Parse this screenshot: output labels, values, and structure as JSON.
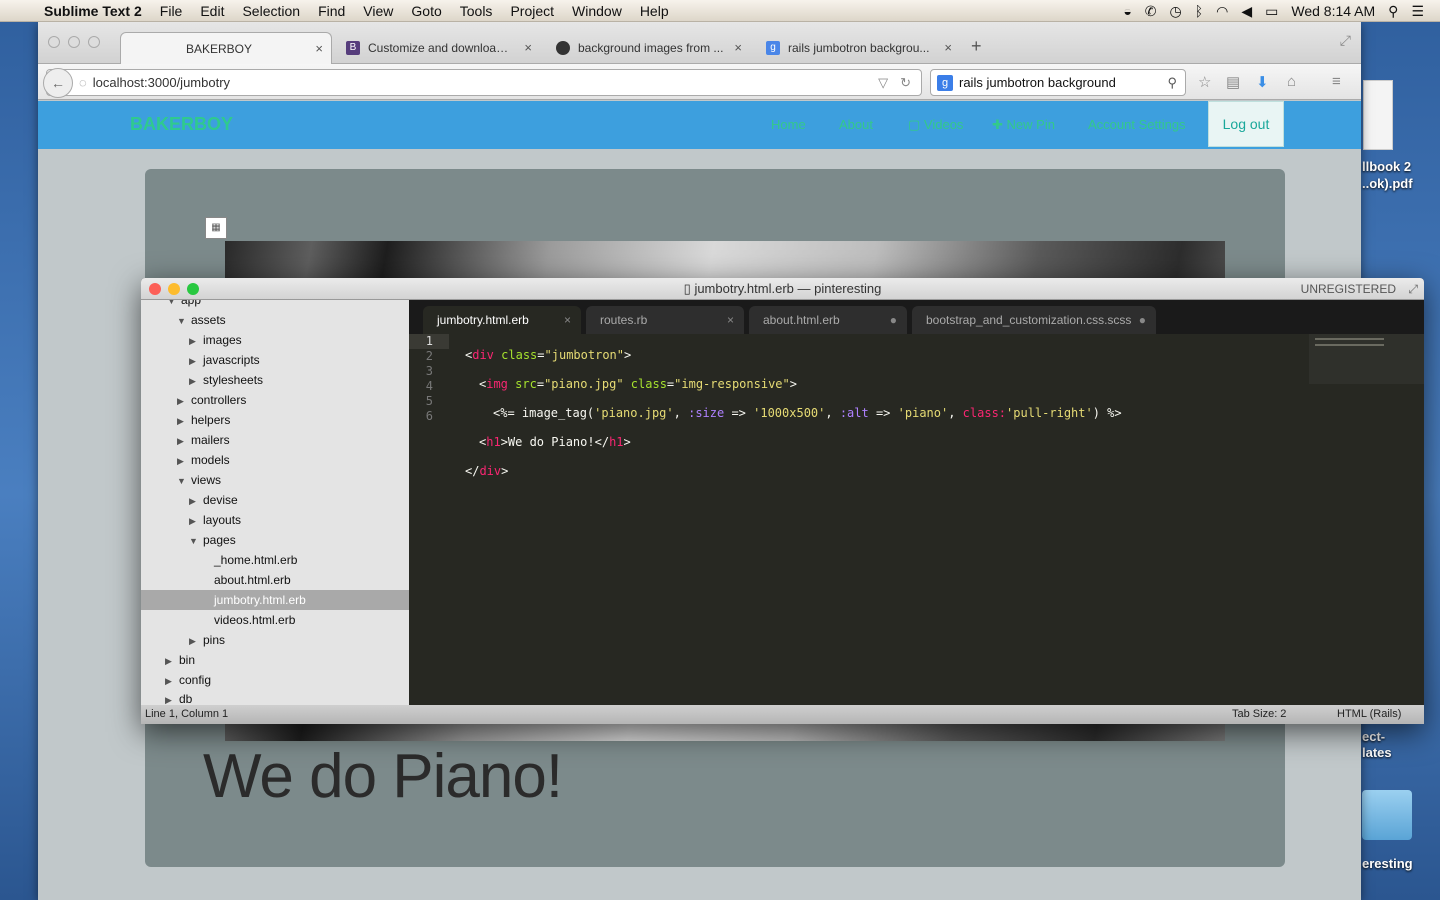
{
  "menubar": {
    "app_name": "Sublime Text 2",
    "items": [
      "File",
      "Edit",
      "Selection",
      "Find",
      "View",
      "Goto",
      "Tools",
      "Project",
      "Window",
      "Help"
    ],
    "clock": "Wed 8:14 AM"
  },
  "desktop": {
    "items": [
      {
        "label": "llbook 2"
      },
      {
        "label": "..ok).pdf"
      },
      {
        "label": "ect-"
      },
      {
        "label": "lates"
      },
      {
        "label": "eresting"
      }
    ]
  },
  "browser": {
    "tabs": [
      {
        "label": "BAKERBOY",
        "active": true
      },
      {
        "label": "Customize and download ..."
      },
      {
        "label": "background images from ..."
      },
      {
        "label": "rails jumbotron backgrou..."
      }
    ],
    "url": "localhost:3000/jumbotry",
    "search_text": "rails jumbotron background"
  },
  "site": {
    "brand": "BAKERBOY",
    "nav": [
      "Home",
      "About",
      "Videos",
      "New Pin",
      "Account Settings"
    ],
    "logout": "Log out",
    "hero_text": "We do Piano!",
    "colors": {
      "navbar": "#3d9fde",
      "nav_text": "#33c98a",
      "jumbotron": "#7c8a8b"
    }
  },
  "sublime": {
    "title": "jumbotry.html.erb — pinteresting",
    "unregistered": "UNREGISTERED",
    "tree": [
      {
        "label": "app",
        "type": "folder-open"
      },
      {
        "label": "assets",
        "type": "folder-open"
      },
      {
        "label": "images",
        "type": "folder"
      },
      {
        "label": "javascripts",
        "type": "folder"
      },
      {
        "label": "stylesheets",
        "type": "folder"
      },
      {
        "label": "controllers",
        "type": "folder"
      },
      {
        "label": "helpers",
        "type": "folder"
      },
      {
        "label": "mailers",
        "type": "folder"
      },
      {
        "label": "models",
        "type": "folder"
      },
      {
        "label": "views",
        "type": "folder-open"
      },
      {
        "label": "devise",
        "type": "folder"
      },
      {
        "label": "layouts",
        "type": "folder"
      },
      {
        "label": "pages",
        "type": "folder-open"
      },
      {
        "label": "_home.html.erb",
        "type": "file"
      },
      {
        "label": "about.html.erb",
        "type": "file"
      },
      {
        "label": "jumbotry.html.erb",
        "type": "file",
        "selected": true
      },
      {
        "label": "videos.html.erb",
        "type": "file"
      },
      {
        "label": "pins",
        "type": "folder"
      },
      {
        "label": "bin",
        "type": "folder"
      },
      {
        "label": "config",
        "type": "folder"
      },
      {
        "label": "db",
        "type": "folder"
      }
    ],
    "tabs": [
      {
        "label": "jumbotry.html.erb",
        "active": true,
        "marker": "×"
      },
      {
        "label": "routes.rb",
        "marker": "×"
      },
      {
        "label": "about.html.erb",
        "marker": "●"
      },
      {
        "label": "bootstrap_and_customization.css.scss",
        "marker": "●"
      }
    ],
    "line_numbers": [
      "1",
      "2",
      "3",
      "4",
      "5",
      "6"
    ],
    "code": {
      "l1": [
        "<",
        "div",
        " ",
        "class",
        "=",
        "\"jumbotron\"",
        ">"
      ],
      "l2": [
        "<",
        "img",
        " ",
        "src",
        "=",
        "\"piano.jpg\"",
        " ",
        "class",
        "=",
        "\"img-responsive\"",
        ">"
      ],
      "l3": [
        "<%= image_tag(",
        "'piano.jpg'",
        ", ",
        ":size",
        " => ",
        "'1000x500'",
        ", ",
        ":alt",
        " => ",
        "'piano'",
        ", ",
        "class:",
        "'pull-right'",
        ") %>"
      ],
      "l4": [
        "<",
        "h1",
        ">We do Piano!</",
        "h1",
        ">"
      ],
      "l5": [
        "</",
        "div",
        ">"
      ]
    },
    "status_left": "Line 1, Column 1",
    "tab_size": "Tab Size: 2",
    "syntax": "HTML (Rails)"
  }
}
